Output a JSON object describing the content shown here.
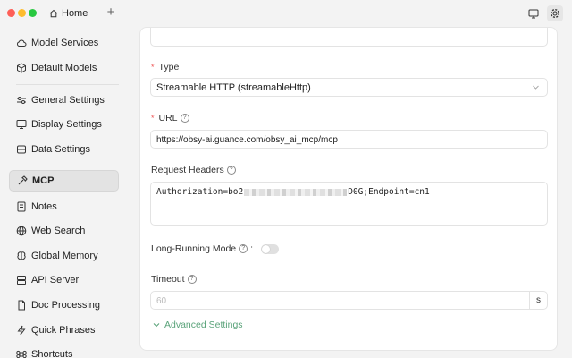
{
  "titlebar": {
    "home_tab": "Home",
    "new_tab": "+"
  },
  "sidebar": {
    "items": [
      {
        "label": "Model Services",
        "icon": "cloud-icon"
      },
      {
        "label": "Default Models",
        "icon": "cube-icon"
      },
      {
        "label": "General Settings",
        "icon": "sliders-icon"
      },
      {
        "label": "Display Settings",
        "icon": "monitor-icon"
      },
      {
        "label": "Data Settings",
        "icon": "database-icon"
      },
      {
        "label": "MCP",
        "icon": "hammer-icon",
        "active": true
      },
      {
        "label": "Notes",
        "icon": "note-icon"
      },
      {
        "label": "Web Search",
        "icon": "globe-icon"
      },
      {
        "label": "Global Memory",
        "icon": "brain-icon"
      },
      {
        "label": "API Server",
        "icon": "server-icon"
      },
      {
        "label": "Doc Processing",
        "icon": "document-icon"
      },
      {
        "label": "Quick Phrases",
        "icon": "zap-icon"
      },
      {
        "label": "Shortcuts",
        "icon": "command-icon"
      }
    ]
  },
  "form": {
    "type_label": "Type",
    "type_value": "Streamable HTTP (streamableHttp)",
    "url_label": "URL",
    "url_value": "https://obsy-ai.guance.com/obsy_ai_mcp/mcp",
    "headers_label": "Request Headers",
    "headers_prefix": "Authorization=bo2",
    "headers_suffix": "D0G;Endpoint=cn1",
    "long_running_label": "Long-Running Mode",
    "long_running_colon": ":",
    "long_running_on": false,
    "timeout_label": "Timeout",
    "timeout_placeholder": "60",
    "timeout_unit": "s",
    "advanced_label": "Advanced Settings"
  },
  "colors": {
    "accent": "#5aa37a",
    "required": "#e55555"
  }
}
